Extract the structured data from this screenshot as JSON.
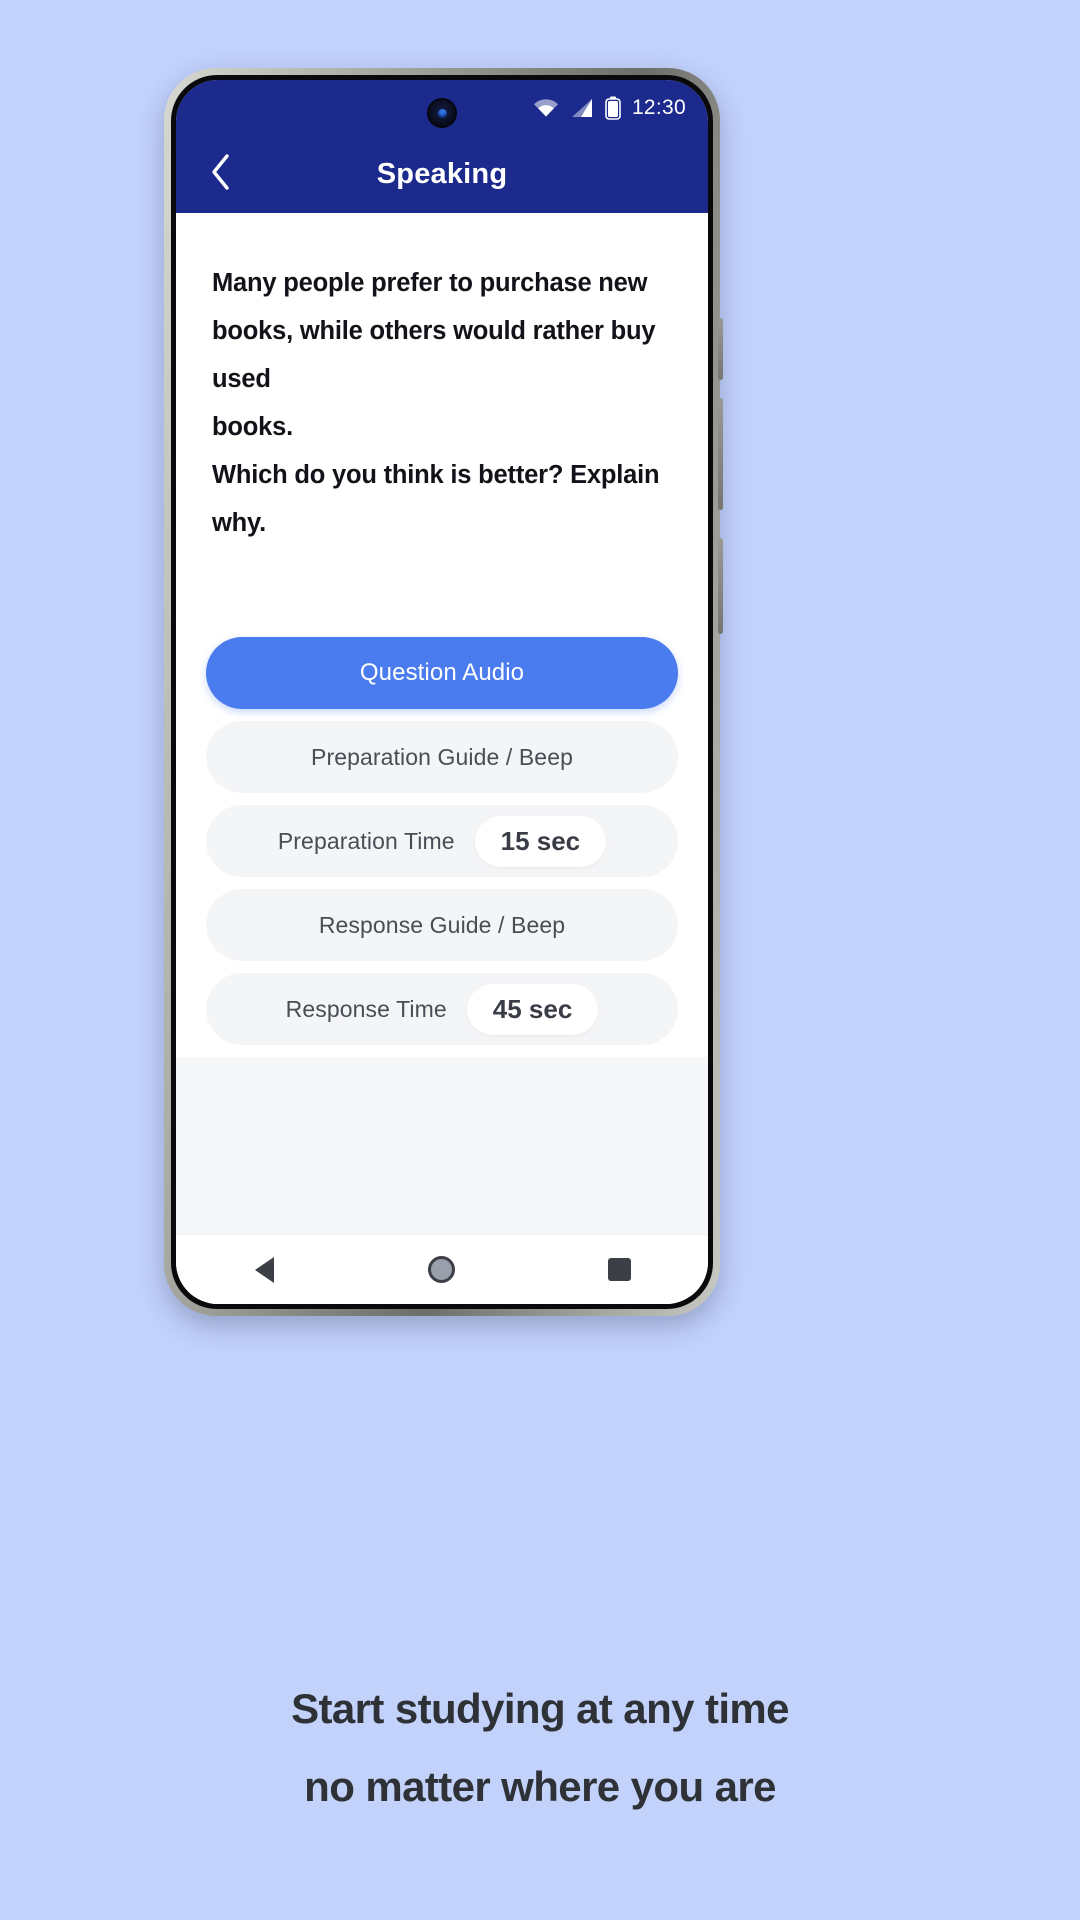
{
  "status_bar": {
    "time": "12:30",
    "icons": [
      "wifi-icon",
      "cellular-signal-icon",
      "battery-icon"
    ]
  },
  "app_bar": {
    "back_icon": "chevron-left-icon",
    "title": "Speaking"
  },
  "question": {
    "lines": [
      "Many people prefer to purchase new",
      "books, while others would rather buy used",
      "books.",
      "Which do you think is better? Explain why."
    ]
  },
  "actions": [
    {
      "label": "Question Audio",
      "style": "primary",
      "value": null
    },
    {
      "label": "Preparation Guide / Beep",
      "style": "plain",
      "value": null
    },
    {
      "label": "Preparation Time",
      "style": "plain",
      "value": "15 sec"
    },
    {
      "label": "Response Guide / Beep",
      "style": "plain",
      "value": null
    },
    {
      "label": "Response Time",
      "style": "plain",
      "value": "45 sec"
    }
  ],
  "nav_bar": {
    "back": "back-triangle-icon",
    "home": "home-circle-icon",
    "recents": "recents-square-icon"
  },
  "caption": {
    "lines": [
      "Start studying at any time",
      "no matter where you are"
    ]
  },
  "colors": {
    "background": "#c2d2fb",
    "app_bar": "#1b2a8c",
    "primary_button": "#4a7cef",
    "row_background": "#f4f5f7",
    "caption_text": "#2e3136"
  }
}
